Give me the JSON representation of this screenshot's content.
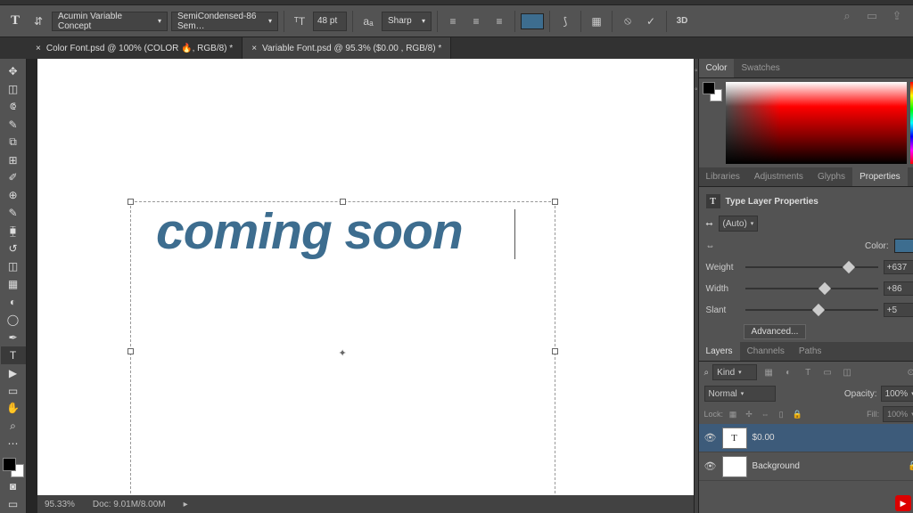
{
  "optionsBar": {
    "fontFamily": "Acumin Variable Concept",
    "fontStyle": "SemiCondensed-86 Sem…",
    "fontSize": "48 pt",
    "antiAlias": "Sharp",
    "threeD": "3D"
  },
  "tabs": [
    {
      "label": "Color Font.psd @ 100% (COLOR 🔥, RGB/8) *",
      "active": false
    },
    {
      "label": "Variable Font.psd @ 95.3% ($0.00    , RGB/8) *",
      "active": true
    }
  ],
  "canvas": {
    "text": "coming soon",
    "zoom": "95.33%",
    "docInfo": "Doc: 9.01M/8.00M"
  },
  "colorPanel": {
    "tab1": "Color",
    "tab2": "Swatches"
  },
  "propsTabs": {
    "t1": "Libraries",
    "t2": "Adjustments",
    "t3": "Glyphs",
    "t4": "Properties"
  },
  "properties": {
    "title": "Type Layer Properties",
    "leading": "(Auto)",
    "colorLabel": "Color:",
    "weight": {
      "label": "Weight",
      "value": "+637",
      "pos": 78
    },
    "width": {
      "label": "Width",
      "value": "+86",
      "pos": 60
    },
    "slant": {
      "label": "Slant",
      "value": "+5",
      "pos": 55
    },
    "advanced": "Advanced..."
  },
  "layersTabs": {
    "t1": "Layers",
    "t2": "Channels",
    "t3": "Paths"
  },
  "layers": {
    "kind": "Kind",
    "blend": "Normal",
    "opacityLabel": "Opacity:",
    "opacity": "100%",
    "lockLabel": "Lock:",
    "fillLabel": "Fill:",
    "fill": "100%",
    "items": [
      {
        "name": "$0.00",
        "thumb": "T",
        "selected": true,
        "locked": false
      },
      {
        "name": "Background",
        "thumb": "",
        "selected": false,
        "locked": true
      }
    ]
  }
}
